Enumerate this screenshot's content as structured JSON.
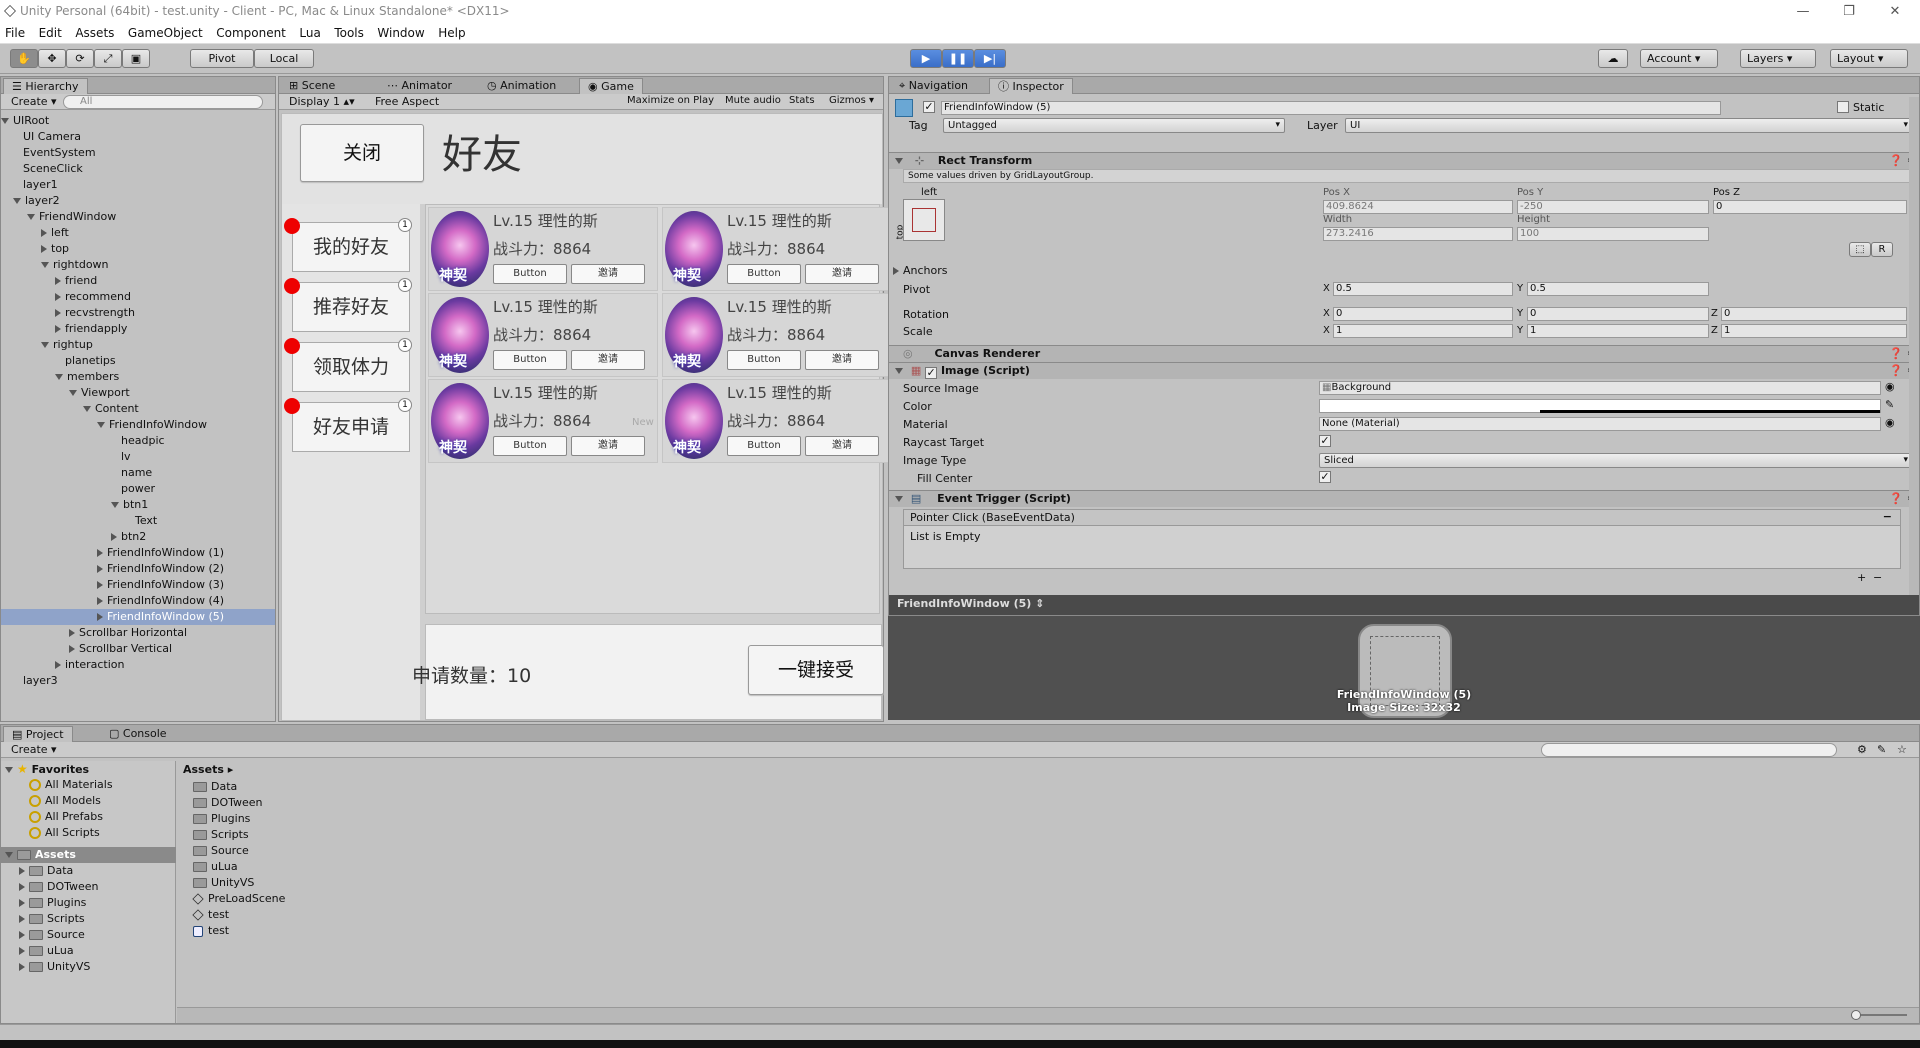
{
  "window": {
    "title": "Unity Personal (64bit) - test.unity - Client - PC, Mac & Linux Standalone* <DX11>"
  },
  "menu": [
    "File",
    "Edit",
    "Assets",
    "GameObject",
    "Component",
    "Lua",
    "Tools",
    "Window",
    "Help"
  ],
  "toolbar": {
    "pivot": "Pivot",
    "local": "Local",
    "account": "Account",
    "layers": "Layers",
    "layout": "Layout"
  },
  "hierarchy": {
    "tab": "Hierarchy",
    "create": "Create",
    "search_placeholder": "All",
    "items": [
      {
        "label": "UIRoot",
        "indent": 0,
        "arrow": "down"
      },
      {
        "label": "UI Camera",
        "indent": 1,
        "arrow": ""
      },
      {
        "label": "EventSystem",
        "indent": 1,
        "arrow": ""
      },
      {
        "label": "SceneClick",
        "indent": 1,
        "arrow": ""
      },
      {
        "label": "layer1",
        "indent": 1,
        "arrow": ""
      },
      {
        "label": "layer2",
        "indent": 1,
        "arrow": "down"
      },
      {
        "label": "FriendWindow",
        "indent": 2,
        "arrow": "down"
      },
      {
        "label": "left",
        "indent": 3,
        "arrow": "right"
      },
      {
        "label": "top",
        "indent": 3,
        "arrow": "right"
      },
      {
        "label": "rightdown",
        "indent": 3,
        "arrow": "down"
      },
      {
        "label": "friend",
        "indent": 4,
        "arrow": "right"
      },
      {
        "label": "recommend",
        "indent": 4,
        "arrow": "right"
      },
      {
        "label": "recvstrength",
        "indent": 4,
        "arrow": "right"
      },
      {
        "label": "friendapply",
        "indent": 4,
        "arrow": "right"
      },
      {
        "label": "rightup",
        "indent": 3,
        "arrow": "down"
      },
      {
        "label": "planetips",
        "indent": 4,
        "arrow": ""
      },
      {
        "label": "members",
        "indent": 4,
        "arrow": "down"
      },
      {
        "label": "Viewport",
        "indent": 5,
        "arrow": "down"
      },
      {
        "label": "Content",
        "indent": 6,
        "arrow": "down"
      },
      {
        "label": "FriendInfoWindow",
        "indent": 7,
        "arrow": "down"
      },
      {
        "label": "headpic",
        "indent": 8,
        "arrow": ""
      },
      {
        "label": "lv",
        "indent": 8,
        "arrow": ""
      },
      {
        "label": "name",
        "indent": 8,
        "arrow": ""
      },
      {
        "label": "power",
        "indent": 8,
        "arrow": ""
      },
      {
        "label": "btn1",
        "indent": 8,
        "arrow": "down"
      },
      {
        "label": "Text",
        "indent": 9,
        "arrow": ""
      },
      {
        "label": "btn2",
        "indent": 8,
        "arrow": "right"
      },
      {
        "label": "FriendInfoWindow (1)",
        "indent": 7,
        "arrow": "right"
      },
      {
        "label": "FriendInfoWindow (2)",
        "indent": 7,
        "arrow": "right"
      },
      {
        "label": "FriendInfoWindow (3)",
        "indent": 7,
        "arrow": "right"
      },
      {
        "label": "FriendInfoWindow (4)",
        "indent": 7,
        "arrow": "right"
      },
      {
        "label": "FriendInfoWindow (5)",
        "indent": 7,
        "arrow": "right",
        "selected": true
      },
      {
        "label": "Scrollbar Horizontal",
        "indent": 5,
        "arrow": "right"
      },
      {
        "label": "Scrollbar Vertical",
        "indent": 5,
        "arrow": "right"
      },
      {
        "label": "interaction",
        "indent": 4,
        "arrow": "right"
      },
      {
        "label": "layer3",
        "indent": 1,
        "arrow": ""
      }
    ]
  },
  "center_tabs": {
    "scene": "Scene",
    "animator": "Animator",
    "animation": "Animation",
    "game": "Game"
  },
  "game_bar": {
    "display": "Display 1",
    "aspect": "Free Aspect",
    "maximize": "Maximize on Play",
    "mute": "Mute audio",
    "stats": "Stats",
    "gizmos": "Gizmos"
  },
  "game": {
    "close": "关闭",
    "title": "好友",
    "side": [
      "我的好友",
      "推荐好友",
      "领取体力",
      "好友申请"
    ],
    "badge": "1",
    "card_level": "Lv.15 理性的斯",
    "card_power": "战斗力：8864",
    "card_btn1": "Button",
    "card_btn2": "邀请",
    "avatar_text": "神契",
    "new_text": "New",
    "apply_count": "申请数量：10",
    "accept_all": "一键接受"
  },
  "right_tabs": {
    "navigation": "Navigation",
    "inspector": "Inspector"
  },
  "inspector": {
    "object_name": "FriendInfoWindow (5)",
    "static": "Static",
    "tag_label": "Tag",
    "tag": "Untagged",
    "layer_label": "Layer",
    "layer": "UI",
    "rect_transform": "Rect Transform",
    "driven_note": "Some values driven by GridLayoutGroup.",
    "anchor_h": "left",
    "anchor_v": "top",
    "pos_x_label": "Pos X",
    "pos_y_label": "Pos Y",
    "pos_z_label": "Pos Z",
    "pos_x": "409.8624",
    "pos_y": "-250",
    "pos_z": "0",
    "width_label": "Width",
    "height_label": "Height",
    "width": "273.2416",
    "height": "100",
    "r_btn": "R",
    "anchors": "Anchors",
    "pivot_label": "Pivot",
    "pivot_x": "0.5",
    "pivot_y": "0.5",
    "rotation_label": "Rotation",
    "rot_x": "0",
    "rot_y": "0",
    "rot_z": "0",
    "scale_label": "Scale",
    "scale_x": "1",
    "scale_y": "1",
    "scale_z": "1",
    "canvas_renderer": "Canvas Renderer",
    "image_script": "Image (Script)",
    "source_image_label": "Source Image",
    "source_image": "Background",
    "color_label": "Color",
    "material_label": "Material",
    "material": "None (Material)",
    "raycast_label": "Raycast Target",
    "image_type_label": "Image Type",
    "image_type": "Sliced",
    "fill_center_label": "Fill Center",
    "event_trigger": "Event Trigger (Script)",
    "pointer_click": "Pointer Click (BaseEventData)",
    "list_empty": "List is Empty",
    "preview_title": "FriendInfoWindow (5)",
    "preview_caption1": "FriendInfoWindow (5)",
    "preview_caption2": "Image Size: 32x32",
    "x": "X",
    "y": "Y",
    "z": "Z"
  },
  "bottom_tabs": {
    "project": "Project",
    "console": "Console",
    "create": "Create"
  },
  "favorites": {
    "title": "Favorites",
    "items": [
      "All Materials",
      "All Models",
      "All Prefabs",
      "All Scripts"
    ]
  },
  "assets_tree": {
    "title": "Assets",
    "items": [
      "Data",
      "DOTween",
      "Plugins",
      "Scripts",
      "Source",
      "uLua",
      "UnityVS"
    ]
  },
  "assets_list": {
    "breadcrumb": "Assets",
    "folders": [
      "Data",
      "DOTween",
      "Plugins",
      "Scripts",
      "Source",
      "uLua",
      "UnityVS"
    ],
    "files": [
      {
        "label": "PreLoadScene",
        "kind": "unity"
      },
      {
        "label": "test",
        "kind": "unity"
      },
      {
        "label": "test",
        "kind": "lua"
      }
    ]
  },
  "colors": {
    "selected_row": "#8fa3c9",
    "play_blue": "#3a6ec8",
    "red_dot": "#e00000"
  }
}
